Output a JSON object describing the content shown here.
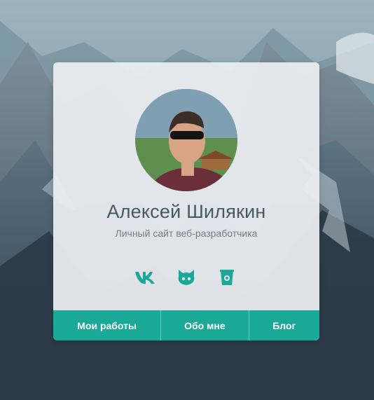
{
  "profile": {
    "name": "Алексей Шилякин",
    "subtitle": "Личный сайт веб-разработчика"
  },
  "socials": [
    {
      "icon": "vk-icon"
    },
    {
      "icon": "github-icon"
    },
    {
      "icon": "bucket-icon"
    }
  ],
  "nav": {
    "items": [
      {
        "label": "Мои работы"
      },
      {
        "label": "Обо мне"
      },
      {
        "label": "Блог"
      }
    ]
  },
  "colors": {
    "accent": "#1aa997",
    "name_text": "#455a64",
    "subtitle_text": "#6f7f88",
    "card_bg": "#eceef1"
  }
}
